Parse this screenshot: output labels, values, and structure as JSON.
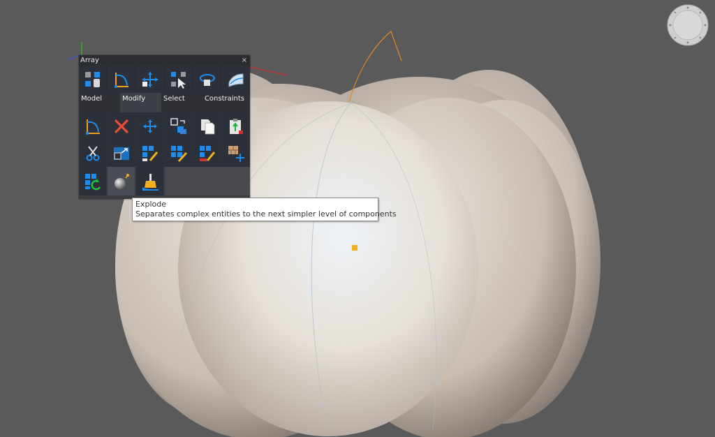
{
  "quad": {
    "title": "Array",
    "close_glyph": "×",
    "top_row": [
      {
        "name": "array-icon",
        "label": "Array"
      },
      {
        "name": "rotate-icon",
        "label": "Rotate"
      },
      {
        "name": "move-icon",
        "label": "Move"
      },
      {
        "name": "select-cursor-icon",
        "label": "Select"
      },
      {
        "name": "orbit-icon",
        "label": "Orbit"
      },
      {
        "name": "drawing-icon",
        "label": "Drawing"
      }
    ],
    "categories": [
      {
        "label": "Model",
        "active": false
      },
      {
        "label": "Modify",
        "active": true
      },
      {
        "label": "Select",
        "active": false
      },
      {
        "label": "Constraints",
        "active": false
      }
    ],
    "row2": [
      {
        "name": "rotate-icon"
      },
      {
        "name": "delete-icon"
      },
      {
        "name": "move-icon"
      },
      {
        "name": "copy-objects-icon"
      },
      {
        "name": "copy-icon"
      },
      {
        "name": "paste-icon"
      }
    ],
    "row3": [
      {
        "name": "cut-icon"
      },
      {
        "name": "scale-icon"
      },
      {
        "name": "array-edit-icon"
      },
      {
        "name": "array-edit-pencil-icon"
      },
      {
        "name": "array-edit-red-icon"
      },
      {
        "name": "brick-move-icon"
      }
    ],
    "row4": [
      {
        "name": "array-reset-icon"
      },
      {
        "name": "explode-icon"
      },
      {
        "name": "brush-icon"
      }
    ]
  },
  "tooltip": {
    "title": "Explode",
    "description": "Separates complex entities to the next simpler level of components"
  },
  "colors": {
    "viewport_bg": "#5a5a5a",
    "accent_orange": "#f0b01e",
    "axis_red": "#d03030",
    "axis_green": "#30c030",
    "axis_blue": "#3050e0"
  }
}
